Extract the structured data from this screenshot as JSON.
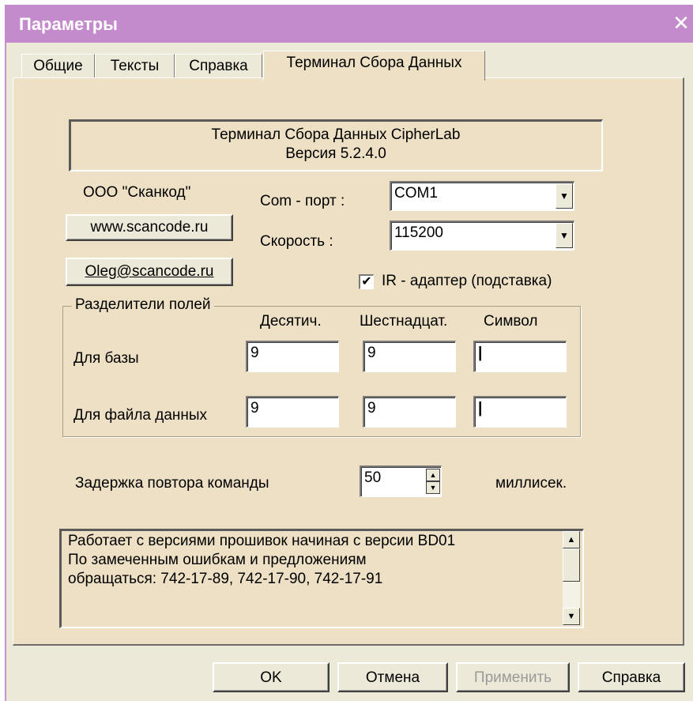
{
  "window": {
    "title": "Параметры",
    "close_glyph": "✕"
  },
  "tabs": [
    {
      "label": "Общие",
      "active": false
    },
    {
      "label": "Тексты",
      "active": false
    },
    {
      "label": "Справка",
      "active": false
    },
    {
      "label": "Терминал Сбора Данных",
      "active": true
    }
  ],
  "header": {
    "line1": "Терминал Сбора Данных CipherLab",
    "line2": "Версия 5.2.4.0"
  },
  "company": {
    "name": "ООО \"Сканкод\"",
    "website_button": "www.scancode.ru",
    "email_button": "Oleg@scancode.ru"
  },
  "com_port": {
    "label": "Com - порт :",
    "value": "COM1"
  },
  "speed": {
    "label": "Скорость :",
    "value": "115200"
  },
  "ir_adapter": {
    "label": "IR - адаптер (подставка)",
    "checked": true,
    "check_glyph": "✔"
  },
  "separators": {
    "group_label": "Разделители полей",
    "col_decimal": "Десятич.",
    "col_hex": "Шестнадцат.",
    "col_symbol": "Символ",
    "rows": [
      {
        "label": "Для базы",
        "decimal": "9",
        "hex": "9",
        "symbol": "|"
      },
      {
        "label": "Для файла данных",
        "decimal": "9",
        "hex": "9",
        "symbol": "|"
      }
    ]
  },
  "delay": {
    "label": "Задержка повтора команды",
    "value": "50",
    "unit": "миллисек."
  },
  "notes": {
    "lines": [
      "Работает с версиями прошивок начиная с версии BD01",
      "По замеченным ошибкам и предложениям",
      "обращаться: 742-17-89, 742-17-90, 742-17-91"
    ]
  },
  "buttons": {
    "ok": "OK",
    "cancel": "Отмена",
    "apply": "Применить",
    "help": "Справка"
  },
  "icons": {
    "dropdown": "▼",
    "spin_up": "▲",
    "spin_down": "▼",
    "scroll_up": "▲",
    "scroll_down": "▼"
  }
}
